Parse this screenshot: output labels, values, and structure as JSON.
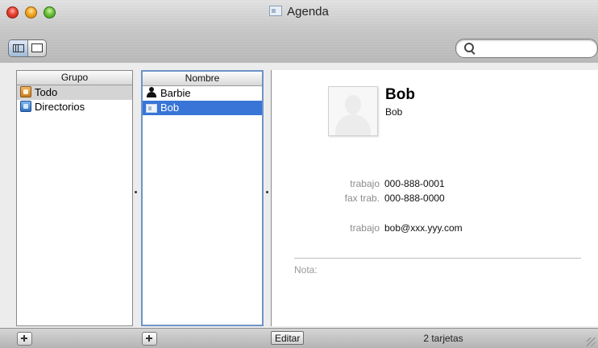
{
  "window": {
    "title": "Agenda"
  },
  "search": {
    "value": "",
    "placeholder": ""
  },
  "columns": {
    "group": {
      "header": "Grupo",
      "items": [
        {
          "label": "Todo",
          "icon": "group-folder-icon",
          "selected": true
        },
        {
          "label": "Directorios",
          "icon": "directory-icon",
          "selected": false
        }
      ]
    },
    "names": {
      "header": "Nombre",
      "items": [
        {
          "label": "Barbie",
          "icon": "person-icon",
          "selected": false
        },
        {
          "label": "Bob",
          "icon": "card-icon",
          "selected": true
        }
      ]
    }
  },
  "card": {
    "name": "Bob",
    "company": "Bob",
    "fields": [
      {
        "label": "trabajo",
        "value": "000-888-0001"
      },
      {
        "label": "fax trab.",
        "value": "000-888-0000"
      },
      {
        "label": "trabajo",
        "value": "bob@xxx.yyy.com"
      }
    ],
    "note_label": "Nota:"
  },
  "bottom": {
    "edit_label": "Editar",
    "count": "2 tarjetas"
  },
  "colors": {
    "selection_blue": "#3875d7",
    "selection_gray": "#d4d4d4",
    "active_column_border": "#6d93c8"
  }
}
